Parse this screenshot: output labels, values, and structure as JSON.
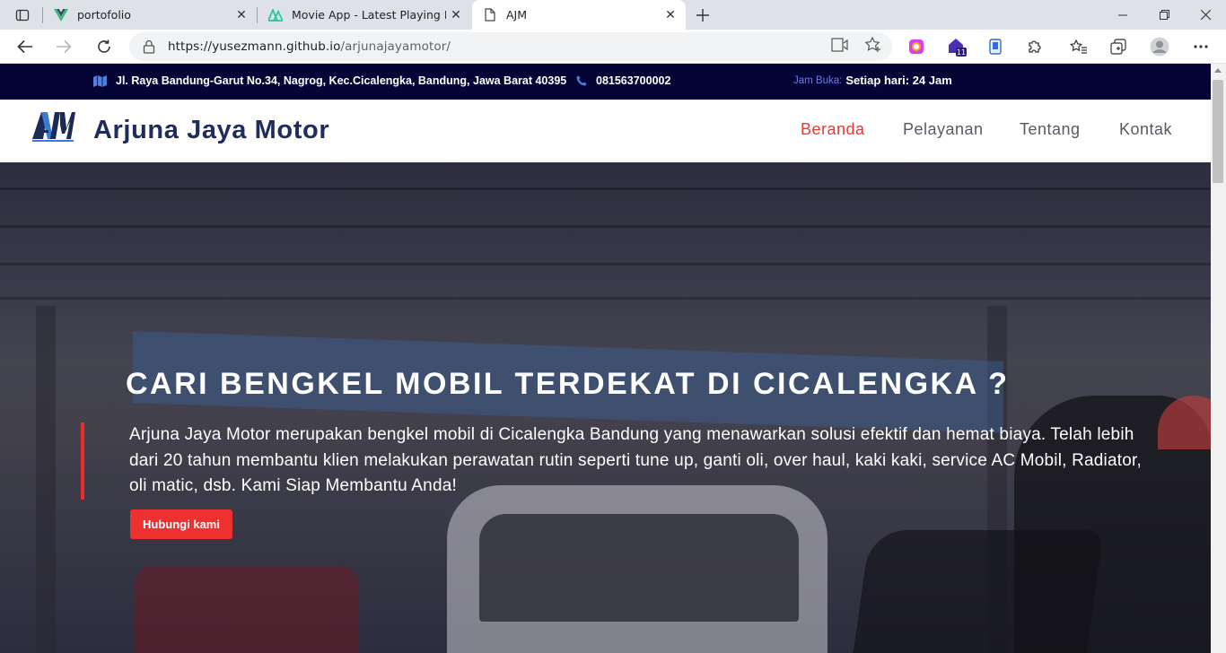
{
  "browser": {
    "tabs": [
      {
        "title": "portofolio",
        "active": false
      },
      {
        "title": "Movie App - Latest Playing Movi",
        "active": false
      },
      {
        "title": "AJM",
        "active": true
      }
    ],
    "url_host": "https://yusezmann.github.io",
    "url_path": "/arjunajayamotor/",
    "collections_badge": "11"
  },
  "topbar": {
    "address": "Jl. Raya Bandung-Garut No.34, Nagrog, Kec.Cicalengka, Bandung, Jawa Barat 40395",
    "phone": "081563700002",
    "hours_label": "Jam Buka:",
    "hours_value": "Setiap hari: 24 Jam"
  },
  "navbar": {
    "logo_text": "AJM",
    "brand": "Arjuna Jaya Motor",
    "menu": [
      {
        "label": "Beranda",
        "active": true
      },
      {
        "label": "Pelayanan",
        "active": false
      },
      {
        "label": "Tentang",
        "active": false
      },
      {
        "label": "Kontak",
        "active": false
      }
    ]
  },
  "hero": {
    "title": "CARI BENGKEL MOBIL TERDEKAT DI CICALENGKA ?",
    "description": "Arjuna Jaya Motor merupakan bengkel mobil di Cicalengka Bandung yang menawarkan solusi efektif dan hemat biaya. Telah lebih dari 20 tahun membantu klien melakukan perawatan rutin seperti tune up, ganti oli, over haul, kaki kaki, service AC Mobil, Radiator, oli matic, dsb. Kami Siap Membantu Anda!",
    "cta": "Hubungi kami"
  },
  "colors": {
    "topbar_bg": "#050535",
    "brand": "#1e2d5c",
    "accent_red": "#ee3030",
    "menu_active": "#e53935"
  }
}
